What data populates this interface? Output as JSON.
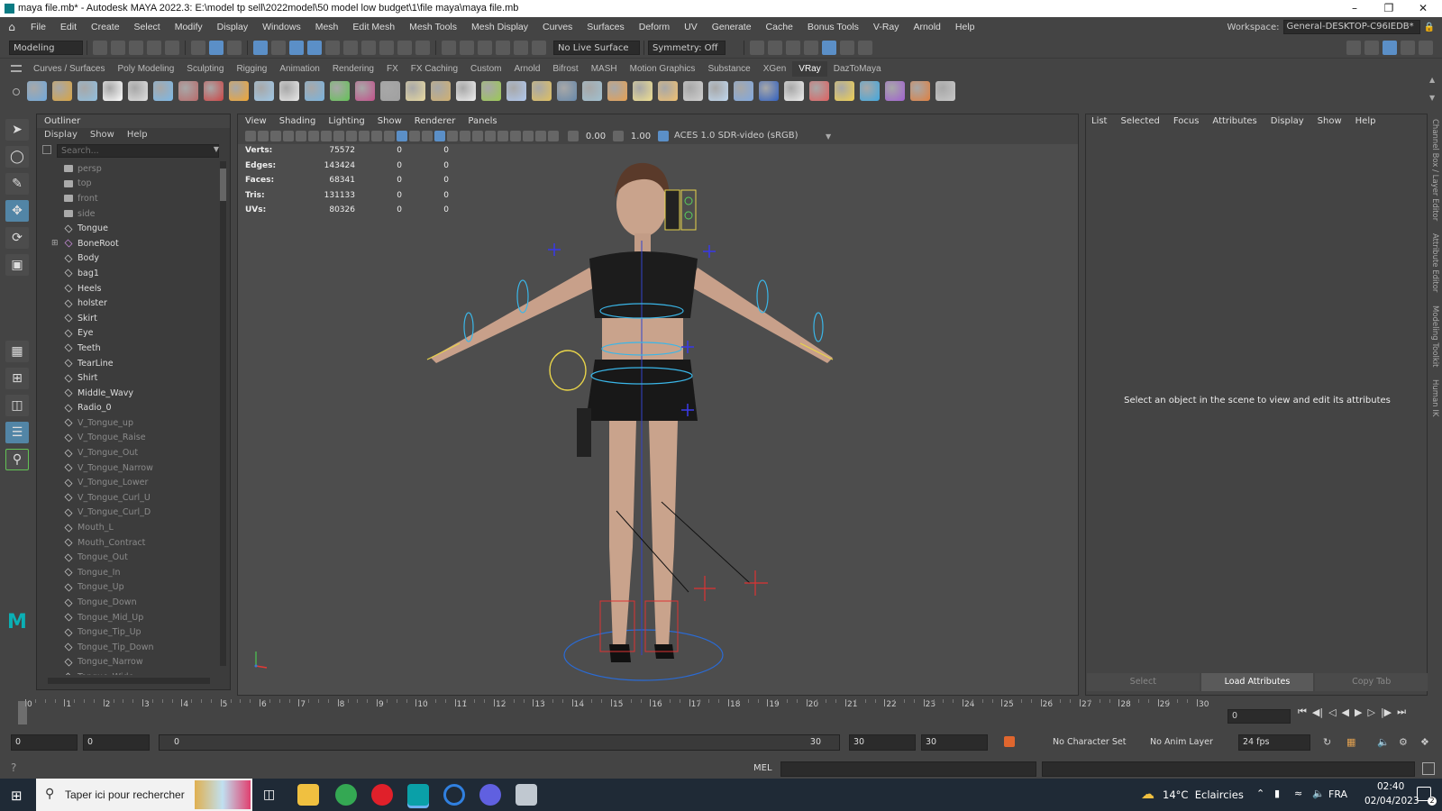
{
  "window": {
    "title": "maya file.mb* - Autodesk MAYA 2022.3: E:\\model tp sell\\2022model\\50 model low budget\\1\\file maya\\maya file.mb",
    "minimize": "–",
    "maximize": "❐",
    "close": "✕"
  },
  "menubar": {
    "items": [
      "File",
      "Edit",
      "Create",
      "Select",
      "Modify",
      "Display",
      "Windows",
      "Mesh",
      "Edit Mesh",
      "Mesh Tools",
      "Mesh Display",
      "Curves",
      "Surfaces",
      "Deform",
      "UV",
      "Generate",
      "Cache",
      "Bonus Tools",
      "V-Ray",
      "Arnold",
      "Help"
    ],
    "workspace_label": "Workspace:",
    "workspace_value": "General-DESKTOP-C96IEDB*"
  },
  "statusline": {
    "mode": "Modeling",
    "live_surface": "No Live Surface",
    "symmetry": "Symmetry: Off"
  },
  "shelf": {
    "tabs": [
      "Curves / Surfaces",
      "Poly Modeling",
      "Sculpting",
      "Rigging",
      "Animation",
      "Rendering",
      "FX",
      "FX Caching",
      "Custom",
      "Arnold",
      "Bifrost",
      "MASH",
      "Motion Graphics",
      "Substance",
      "XGen",
      "VRay",
      "DazToMaya"
    ],
    "active_tab": "VRay",
    "icon_colors": [
      "#6fa8dc",
      "#d9a441",
      "#8fbfe0",
      "#ffffff",
      "#e0e0e0",
      "#7ab8e8",
      "#b86a6a",
      "#cc4444",
      "#f2a530",
      "#9ec8e8",
      "#e8e8e8",
      "#78b4e0",
      "#63c255",
      "#c24f8a",
      "#a0a0a0",
      "#e8d9a0",
      "#d0b070",
      "#f0f0f0",
      "#9bc953",
      "#b0c8f0",
      "#e0c060",
      "#6688aa",
      "#a0c0d0",
      "#e8a050",
      "#f0e090",
      "#f0c070",
      "#d0d0d0",
      "#c0d8f0",
      "#80a8e0",
      "#3060c0",
      "#eeeeee",
      "#e06060",
      "#f0d050",
      "#40a8e0",
      "#a060d0",
      "#e08040",
      "#c8c8c8"
    ]
  },
  "outliner": {
    "title": "Outliner",
    "menu": [
      "Display",
      "Show",
      "Help"
    ],
    "search_placeholder": "Search...",
    "items": [
      {
        "label": "persp",
        "type": "cam",
        "dim": true
      },
      {
        "label": "top",
        "type": "cam",
        "dim": true
      },
      {
        "label": "front",
        "type": "cam",
        "dim": true
      },
      {
        "label": "side",
        "type": "cam",
        "dim": true
      },
      {
        "label": "Tongue",
        "type": "mesh",
        "dim": false
      },
      {
        "label": "BoneRoot",
        "type": "joint",
        "dim": false,
        "expandable": true
      },
      {
        "label": "Body",
        "type": "mesh",
        "dim": false
      },
      {
        "label": "bag1",
        "type": "mesh",
        "dim": false
      },
      {
        "label": "Heels",
        "type": "mesh",
        "dim": false
      },
      {
        "label": "holster",
        "type": "mesh",
        "dim": false
      },
      {
        "label": "Skirt",
        "type": "mesh",
        "dim": false
      },
      {
        "label": "Eye",
        "type": "mesh",
        "dim": false
      },
      {
        "label": "Teeth",
        "type": "mesh",
        "dim": false
      },
      {
        "label": "TearLine",
        "type": "mesh",
        "dim": false
      },
      {
        "label": "Shirt",
        "type": "mesh",
        "dim": false
      },
      {
        "label": "Middle_Wavy",
        "type": "mesh",
        "dim": false
      },
      {
        "label": "Radio_0",
        "type": "mesh",
        "dim": false
      },
      {
        "label": "V_Tongue_up",
        "type": "mesh",
        "dim": true
      },
      {
        "label": "V_Tongue_Raise",
        "type": "mesh",
        "dim": true
      },
      {
        "label": "V_Tongue_Out",
        "type": "mesh",
        "dim": true
      },
      {
        "label": "V_Tongue_Narrow",
        "type": "mesh",
        "dim": true
      },
      {
        "label": "V_Tongue_Lower",
        "type": "mesh",
        "dim": true
      },
      {
        "label": "V_Tongue_Curl_U",
        "type": "mesh",
        "dim": true
      },
      {
        "label": "V_Tongue_Curl_D",
        "type": "mesh",
        "dim": true
      },
      {
        "label": "Mouth_L",
        "type": "mesh",
        "dim": true
      },
      {
        "label": "Mouth_Contract",
        "type": "mesh",
        "dim": true
      },
      {
        "label": "Tongue_Out",
        "type": "mesh",
        "dim": true
      },
      {
        "label": "Tongue_In",
        "type": "mesh",
        "dim": true
      },
      {
        "label": "Tongue_Up",
        "type": "mesh",
        "dim": true
      },
      {
        "label": "Tongue_Down",
        "type": "mesh",
        "dim": true
      },
      {
        "label": "Tongue_Mid_Up",
        "type": "mesh",
        "dim": true
      },
      {
        "label": "Tongue_Tip_Up",
        "type": "mesh",
        "dim": true
      },
      {
        "label": "Tongue_Tip_Down",
        "type": "mesh",
        "dim": true
      },
      {
        "label": "Tongue_Narrow",
        "type": "mesh",
        "dim": true
      },
      {
        "label": "Tongue_Wide",
        "type": "mesh",
        "dim": true
      }
    ]
  },
  "viewport": {
    "menu": [
      "View",
      "Shading",
      "Lighting",
      "Show",
      "Renderer",
      "Panels"
    ],
    "exposure": "0.00",
    "gamma": "1.00",
    "color_space": "ACES 1.0 SDR-video (sRGB)",
    "hud": [
      {
        "label": "Verts:",
        "value": "75572",
        "a": "0",
        "b": "0"
      },
      {
        "label": "Edges:",
        "value": "143424",
        "a": "0",
        "b": "0"
      },
      {
        "label": "Faces:",
        "value": "68341",
        "a": "0",
        "b": "0"
      },
      {
        "label": "Tris:",
        "value": "131133",
        "a": "0",
        "b": "0"
      },
      {
        "label": "UVs:",
        "value": "80326",
        "a": "0",
        "b": "0"
      }
    ]
  },
  "attribute_editor": {
    "menu": [
      "List",
      "Selected",
      "Focus",
      "Attributes",
      "Display",
      "Show",
      "Help"
    ],
    "message": "Select an object in the scene to view and edit its attributes",
    "buttons": [
      "Select",
      "Load Attributes",
      "Copy Tab"
    ],
    "side_tabs": [
      "Channel Box / Layer Editor",
      "Attribute Editor",
      "Modeling Toolkit",
      "Human IK"
    ]
  },
  "timeline": {
    "start": 0,
    "end": 30,
    "current_frame": "0",
    "tick_labels": [
      "0",
      "1",
      "2",
      "3",
      "4",
      "5",
      "6",
      "7",
      "8",
      "9",
      "10",
      "11",
      "12",
      "13",
      "14",
      "15",
      "16",
      "17",
      "18",
      "19",
      "20",
      "21",
      "22",
      "23",
      "24",
      "25",
      "26",
      "27",
      "28",
      "29",
      "30"
    ]
  },
  "range": {
    "start": "0",
    "anim_start": "0",
    "slider_start": "0",
    "slider_end": "30",
    "anim_end": "30",
    "end": "30",
    "character_set": "No Character Set",
    "anim_layer": "No Anim Layer",
    "fps": "24 fps"
  },
  "cmdline": {
    "mode": "MEL"
  },
  "taskbar": {
    "search_placeholder": "Taper ici pour rechercher",
    "weather": "14°C  Eclaircies",
    "lang": "FRA",
    "time": "02:40",
    "date": "02/04/2023",
    "notifications": "2"
  }
}
